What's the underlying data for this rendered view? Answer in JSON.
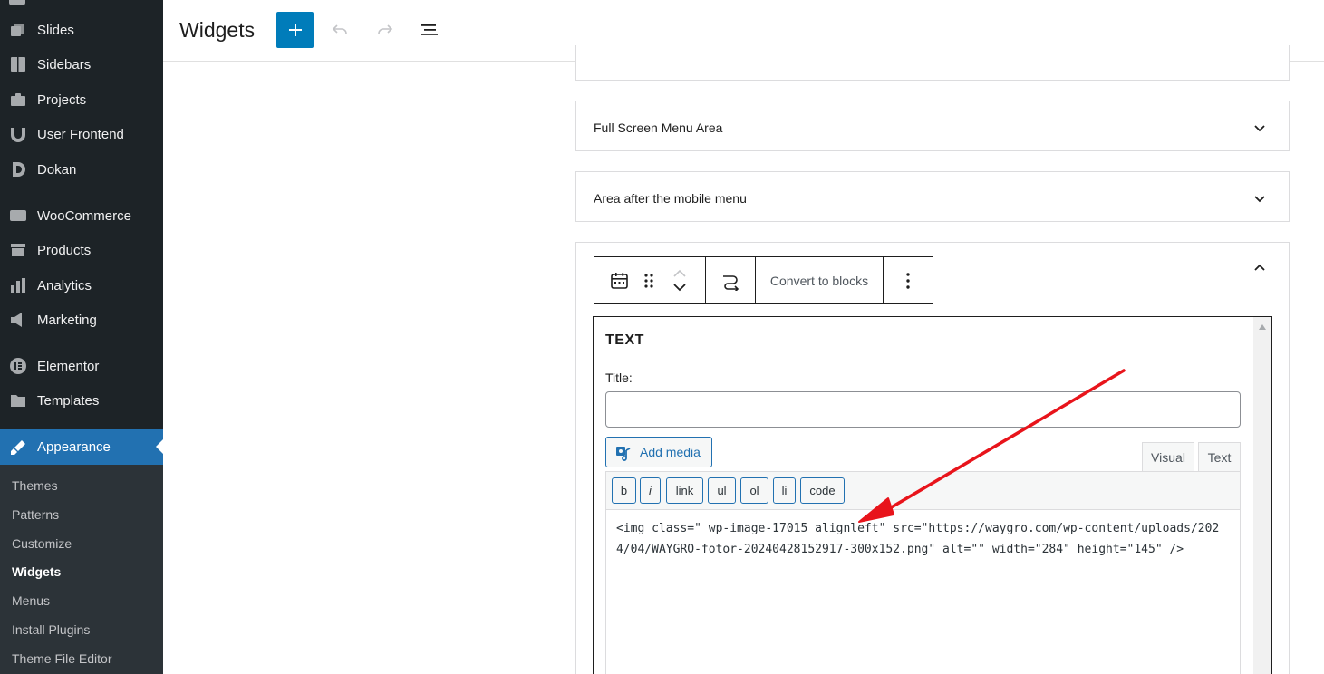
{
  "sidebar": {
    "items": [
      {
        "label": "Slides",
        "icon": "slides-icon"
      },
      {
        "label": "Sidebars",
        "icon": "sidebars-icon"
      },
      {
        "label": "Projects",
        "icon": "projects-icon"
      },
      {
        "label": "User Frontend",
        "icon": "user-frontend-icon"
      },
      {
        "label": "Dokan",
        "icon": "dokan-icon"
      },
      {
        "label": "WooCommerce",
        "icon": "woocommerce-icon"
      },
      {
        "label": "Products",
        "icon": "products-icon"
      },
      {
        "label": "Analytics",
        "icon": "analytics-icon"
      },
      {
        "label": "Marketing",
        "icon": "marketing-icon"
      },
      {
        "label": "Elementor",
        "icon": "elementor-icon"
      },
      {
        "label": "Templates",
        "icon": "templates-icon"
      },
      {
        "label": "Appearance",
        "icon": "appearance-icon"
      }
    ],
    "submenu": [
      "Themes",
      "Patterns",
      "Customize",
      "Widgets",
      "Menus",
      "Install Plugins",
      "Theme File Editor"
    ],
    "current_submenu": "Widgets"
  },
  "header": {
    "title": "Widgets",
    "add_block_label": "+"
  },
  "areas": [
    {
      "label": "",
      "state": "collapsed-partial"
    },
    {
      "label": "Full Screen Menu Area",
      "state": "collapsed"
    },
    {
      "label": "Area after the mobile menu",
      "state": "collapsed"
    }
  ],
  "block_toolbar": {
    "convert_label": "Convert to blocks"
  },
  "text_widget": {
    "heading": "TEXT",
    "title_label": "Title:",
    "title_value": "",
    "add_media_label": "Add media",
    "tab_visual": "Visual",
    "tab_text": "Text",
    "quicktags": [
      "b",
      "i",
      "link",
      "ul",
      "ol",
      "li",
      "code"
    ],
    "content": "<img class=\" wp-image-17015 alignleft\" src=\"https://waygro.com/wp-content/uploads/2024/04/WAYGRO-fotor-20240428152917-300x152.png\" alt=\"\" width=\"284\" height=\"145\" />"
  },
  "colors": {
    "sidebar_bg": "#1d2327",
    "accent": "#2271b1",
    "add_button": "#007cba",
    "annotation_arrow": "#e8141b"
  }
}
